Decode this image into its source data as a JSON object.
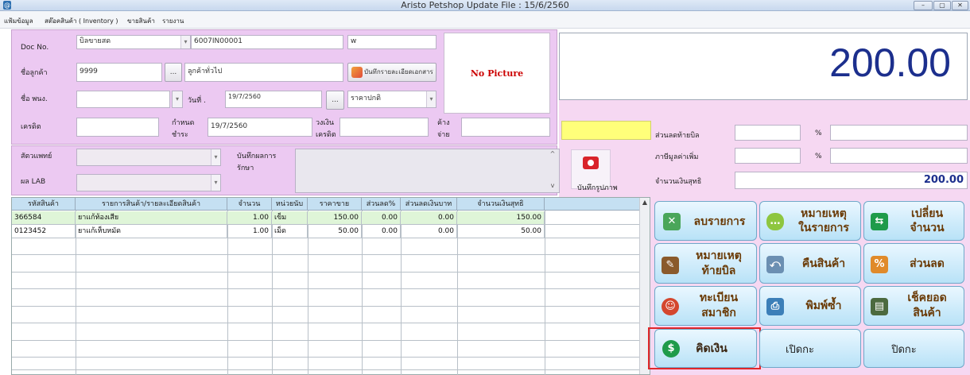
{
  "window": {
    "title": "Aristo Petshop  Update File : 15/6/2560",
    "app_icon": "@",
    "minimize": "–",
    "maximize": "▢",
    "close": "✕"
  },
  "menu": [
    "แฟ้มข้อมูล",
    "สต๊อคสินค้า ( Inventory )",
    "ขายสินค้า",
    "รายงาน"
  ],
  "form": {
    "doc_no_label": "Doc No.",
    "doc_type": "บิลขายสด",
    "doc_no": "6007IN00001",
    "doc_code": "w",
    "customer_label": "ชื่อลูกค้า",
    "customer_code": "9999",
    "customer_name": "ลูกค้าทั่วไป",
    "browse": "...",
    "save_details_label": "บันทึกรายละเอียดเอกสาร",
    "staff_label": "ชื่อ พนง.",
    "date_label": "วันที่ .",
    "date_value": "19/7/2560",
    "price_type": "ราคาปกติ",
    "credit_label": "เครดิต",
    "due_label_1": "กำหนด",
    "due_label_2": "ชำระ",
    "due_value": "19/7/2560",
    "credit_limit_label_1": "วงเงิน",
    "credit_limit_label_2": "เครดิต",
    "outstanding_label_1": "ค้าง",
    "outstanding_label_2": "จ่าย",
    "no_picture": "No Picture"
  },
  "total": {
    "amount": "200.00"
  },
  "summary": {
    "discount_label": "ส่วนลดท้ายบิล",
    "vat_label": "ภาษีมูลค่าเพิ่ม",
    "percent": "%",
    "net_label": "จำนวนเงินสุทธิ",
    "net_value": "200.00"
  },
  "vet": {
    "vet_label": "สัตวแพทย์",
    "lab_label": "ผล LAB",
    "treatment_label_1": "บันทึกผลการ",
    "treatment_label_2": "รักษา",
    "photo_label": "บันทึกรูปภาพ"
  },
  "table": {
    "headers": [
      "รหัสสินค้า",
      "รายการสินค้า/รายละเอียดสินค้า",
      "จำนวน",
      "หน่วยนับ",
      "ราคาขาย",
      "ส่วนลด%",
      "ส่วนลดเงินบาท",
      "จำนวนเงินสุทธิ"
    ],
    "rows": [
      [
        "366584",
        "ยาแก้ท้องเสีย",
        "1.00",
        "เข็ม",
        "150.00",
        "0.00",
        "0.00",
        "150.00"
      ],
      [
        "0123452",
        "ยาแก้เห็บหมัด",
        "1.00",
        "เม็ด",
        "50.00",
        "0.00",
        "0.00",
        "50.00"
      ]
    ]
  },
  "actions": {
    "delete_item": "ลบรายการ",
    "item_note_1": "หมายเหตุ",
    "item_note_2": "ในรายการ",
    "change_qty_1": "เปลี่ยน",
    "change_qty_2": "จำนวน",
    "bill_note_1": "หมายเหตุ",
    "bill_note_2": "ท้ายบิล",
    "return_goods": "คืนสินค้า",
    "discount": "ส่วนลด",
    "register_1": "ทะเบียน",
    "register_2": "สมาชิก",
    "reprint": "พิมพ์ซ้ำ",
    "check_stock_1": "เช็คยอด",
    "check_stock_2": "สินค้า",
    "pay": "คิดเงิน",
    "open_shift": "เปิดกะ",
    "close_shift": "ปิดกะ"
  },
  "colors": {
    "total_text": "#1c2f8d",
    "form_bg": "#ecc9f2",
    "highlight_border": "#e0282b"
  }
}
